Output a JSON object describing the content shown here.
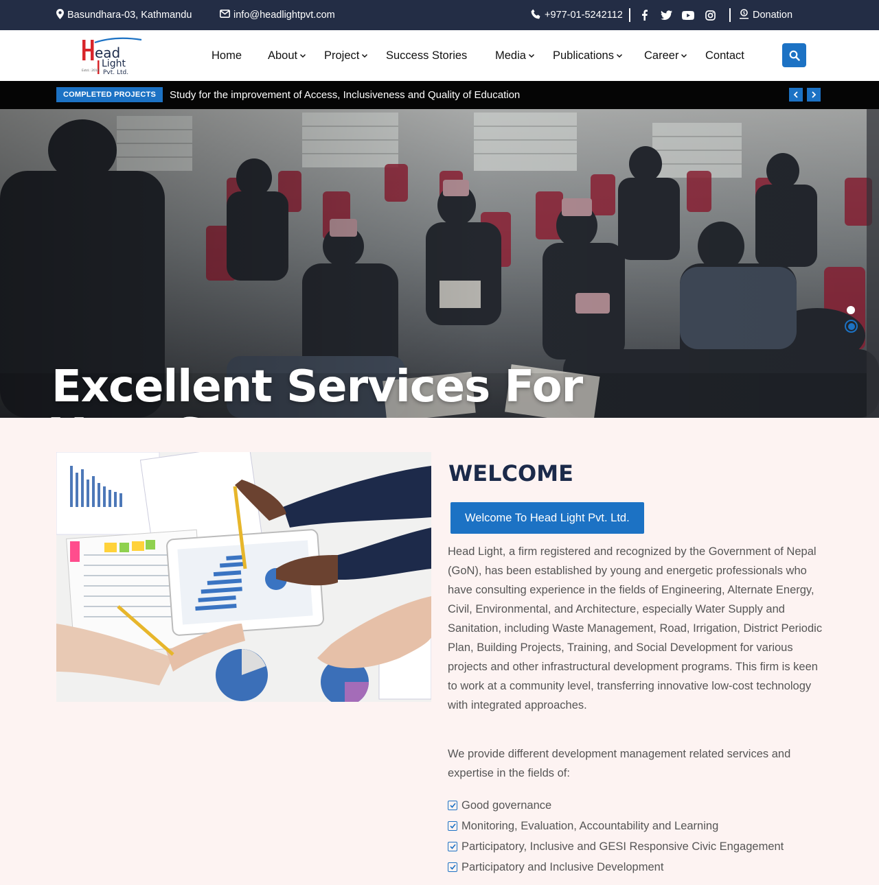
{
  "topbar": {
    "address": "Basundhara-03, Kathmandu",
    "email": "info@headlightpvt.com",
    "phone": "+977-01-5242112",
    "donation": "Donation",
    "social": [
      "facebook-icon",
      "twitter-icon",
      "youtube-icon",
      "instagram-icon"
    ]
  },
  "logo": {
    "line1": "ead",
    "line2": "Light",
    "line3": "Pvt. Ltd.",
    "est": "Estd.: 2016"
  },
  "nav": {
    "items": [
      {
        "label": "Home"
      },
      {
        "label": "About"
      },
      {
        "label": "Project"
      },
      {
        "label": "Success Stories"
      },
      {
        "label": "Media"
      },
      {
        "label": "Publications"
      },
      {
        "label": "Career"
      },
      {
        "label": "Contact"
      }
    ]
  },
  "ticker": {
    "badge": "COMPLETED PROJECTS",
    "text": "Study for the improvement of Access, Inclusiveness and Quality of Education"
  },
  "hero": {
    "line1": "Excellent Services For",
    "line2": "Your Success"
  },
  "welcome": {
    "heading": "WELCOME",
    "subtitle": "Welcome To Head Light Pvt. Ltd.",
    "para1": "Head Light, a firm registered and recognized by the Government of Nepal (GoN), has been established by young and energetic professionals who have consulting experience in the fields of Engineering, Alternate Energy, Civil, Environmental, and Architecture, especially Water Supply and Sanitation, including Waste Management, Road, Irrigation, District Periodic Plan, Building Projects, Training, and Social Development for various projects and other infrastructural development programs. This firm is keen to work at a community level, transferring innovative low-cost technology with integrated approaches.",
    "para2": "We provide different development management related services and expertise in the fields of:",
    "list": [
      "Good governance",
      "Monitoring, Evaluation, Accountability and Learning",
      "Participatory, Inclusive and GESI Responsive Civic Engagement",
      "Participatory and Inclusive Development"
    ]
  },
  "colors": {
    "topbar": "#232d45",
    "accent": "#1c72c4",
    "heading": "#1b2a4a",
    "section_bg": "#fdf3f2"
  }
}
